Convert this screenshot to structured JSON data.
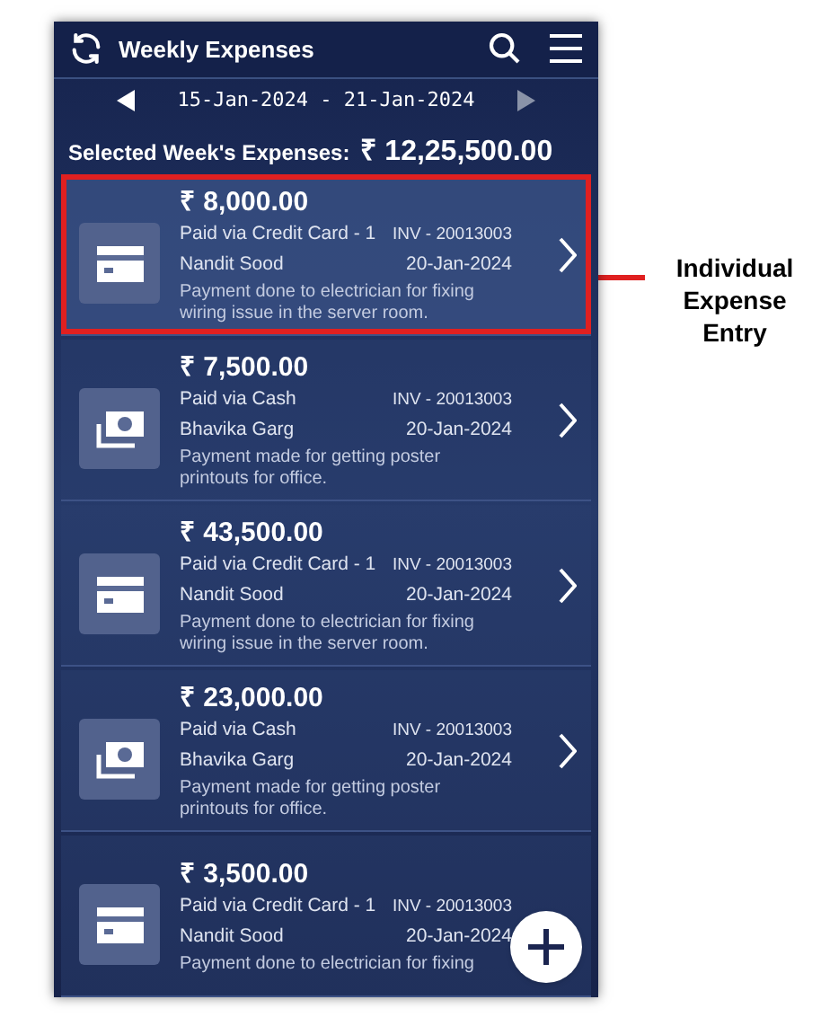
{
  "header": {
    "title": "Weekly Expenses"
  },
  "week": {
    "range": "15-Jan-2024 - 21-Jan-2024"
  },
  "summary": {
    "label": "Selected Week's Expenses:",
    "amount": "₹ 12,25,500.00"
  },
  "expenses": [
    {
      "kind": "card",
      "highlighted": true,
      "amount": "₹ 8,000.00",
      "method": "Paid via Credit Card - 1",
      "invoice": "INV - 20013003",
      "payee": "Nandit Sood",
      "date": "20-Jan-2024",
      "description": "Payment done to electrician for fixing wiring issue in the server room."
    },
    {
      "kind": "cash",
      "highlighted": false,
      "amount": "₹ 7,500.00",
      "method": "Paid via Cash",
      "invoice": "INV - 20013003",
      "payee": "Bhavika Garg",
      "date": "20-Jan-2024",
      "description": "Payment made for getting poster printouts for office."
    },
    {
      "kind": "card",
      "highlighted": false,
      "amount": "₹ 43,500.00",
      "method": "Paid via Credit Card - 1",
      "invoice": "INV - 20013003",
      "payee": "Nandit Sood",
      "date": "20-Jan-2024",
      "description": "Payment done to electrician for fixing wiring issue in the server room."
    },
    {
      "kind": "cash",
      "highlighted": false,
      "amount": "₹ 23,000.00",
      "method": "Paid via Cash",
      "invoice": "INV - 20013003",
      "payee": "Bhavika Garg",
      "date": "20-Jan-2024",
      "description": "Payment made for getting poster printouts for office."
    },
    {
      "kind": "card",
      "highlighted": false,
      "amount": "₹ 3,500.00",
      "method": "Paid via Credit Card - 1",
      "invoice": "INV - 20013003",
      "payee": "Nandit Sood",
      "date": "20-Jan-2024",
      "description": "Payment done to electrician for fixing"
    }
  ],
  "annotation": {
    "label": "Individual Expense Entry"
  }
}
